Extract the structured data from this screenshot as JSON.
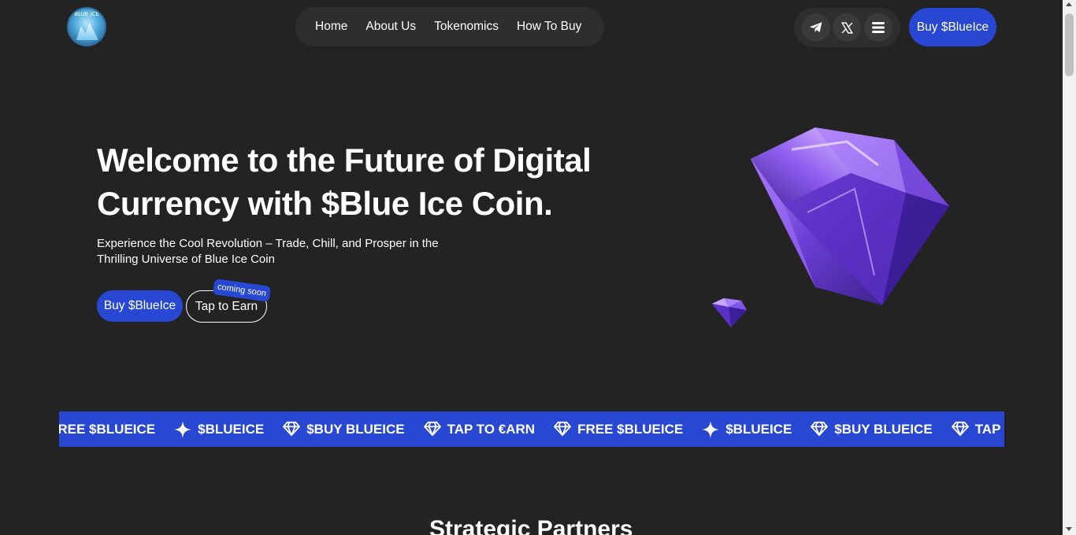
{
  "header": {
    "logo_text": "BLUE ICE",
    "nav": [
      "Home",
      "About Us",
      "Tokenomics",
      "How To Buy"
    ],
    "social": [
      {
        "name": "telegram-icon"
      },
      {
        "name": "x-icon"
      },
      {
        "name": "menu-icon"
      }
    ],
    "buy_label": "Buy $BlueIce"
  },
  "hero": {
    "title_line1": "Welcome to the Future of Digital",
    "title_line2": "Currency with $Blue Ice Coin.",
    "subtitle_line1": "Experience the Cool Revolution – Trade, Chill, and Prosper in the",
    "subtitle_line2": "Thrilling Universe of Blue Ice Coin",
    "buy_label": "Buy $BlueIce",
    "tap_label": "Tap to Earn",
    "badge": "coming soon"
  },
  "marquee": [
    {
      "icon": "diamond-icon",
      "text": "FREE $BLUEICE"
    },
    {
      "icon": "sparkle-icon",
      "text": "$BLUEICE"
    },
    {
      "icon": "diamond-icon",
      "text": "$BUY BLUEICE"
    },
    {
      "icon": "diamond-icon",
      "text": "TAP TO €ARN"
    },
    {
      "icon": "diamond-icon",
      "text": "FREE $BLUEICE"
    },
    {
      "icon": "sparkle-icon",
      "text": "$BLUEICE"
    },
    {
      "icon": "diamond-icon",
      "text": "$BUY BLUEICE"
    },
    {
      "icon": "diamond-icon",
      "text": "TAP TO €ARN"
    }
  ],
  "partners": {
    "title": "Strategic Partners"
  },
  "colors": {
    "background": "#232323",
    "accent": "#2848d3",
    "pill": "#2e2e2e"
  }
}
